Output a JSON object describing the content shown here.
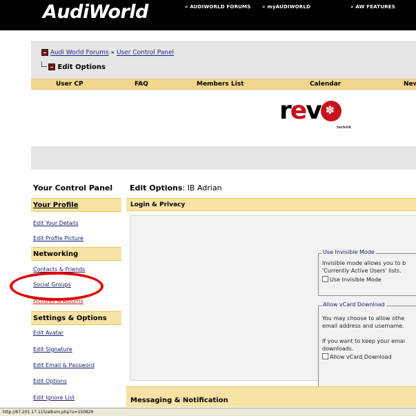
{
  "header": {
    "logo": "AudiWorld",
    "nav": [
      "» AUDIWORLD FORUMS",
      "» myAUDIWORLD",
      "» AW FEATURES"
    ]
  },
  "breadcrumb": {
    "forum_link": "Audi World Forums",
    "separator": "»",
    "ucp_link": "User Control Panel",
    "current": "Edit Options"
  },
  "navbar": {
    "items": [
      "User CP",
      "FAQ",
      "Members List",
      "Calendar",
      "New"
    ]
  },
  "banner": {
    "brand_r": "r",
    "brand_e": "e",
    "brand_v": "v",
    "tagline": "technik"
  },
  "sidebar": {
    "title": "Your Control Panel",
    "profile_heading": "Your Profile",
    "profile_items": [
      "Edit Your Details",
      "Edit Profile Picture"
    ],
    "networking_heading": "Networking",
    "networking_items": [
      "Contacts & Friends",
      "Social Groups",
      "Pictures & Albums"
    ],
    "settings_heading": "Settings & Options",
    "settings_items": [
      "Edit Avatar",
      "Edit Signature",
      "Edit Email & Password",
      "Edit Options",
      "Edit Ignore List"
    ]
  },
  "main": {
    "title_label": "Edit Options",
    "title_user": "IB Adrian",
    "login_section": "Login & Privacy",
    "invisible": {
      "legend": "Use Invisible Mode",
      "line1": "Invisible mode allows you to b",
      "line2": "'Currently Active Users' lists.",
      "checkbox_label": "Use Invisible Mode",
      "checked": false
    },
    "vcard": {
      "legend": "Allow vCard Download",
      "line1": "You may choose to allow othe",
      "line2": "email address and username.",
      "line3": "If you want to keep your emai",
      "line4": "downloads.",
      "checkbox_label": "Allow vCard Download",
      "checked": false
    },
    "messaging_section": "Messaging & Notification"
  },
  "statusbar": {
    "url": "http://67.201.17.115/album.php?u=150829"
  },
  "colors": {
    "header_bg": "#000000",
    "section_bar": "#f7e3a6",
    "navbar_bg": "#f1d68d",
    "link": "#1a1a6a",
    "highlight_ring": "#e00000",
    "brand_red": "#c8121a"
  }
}
